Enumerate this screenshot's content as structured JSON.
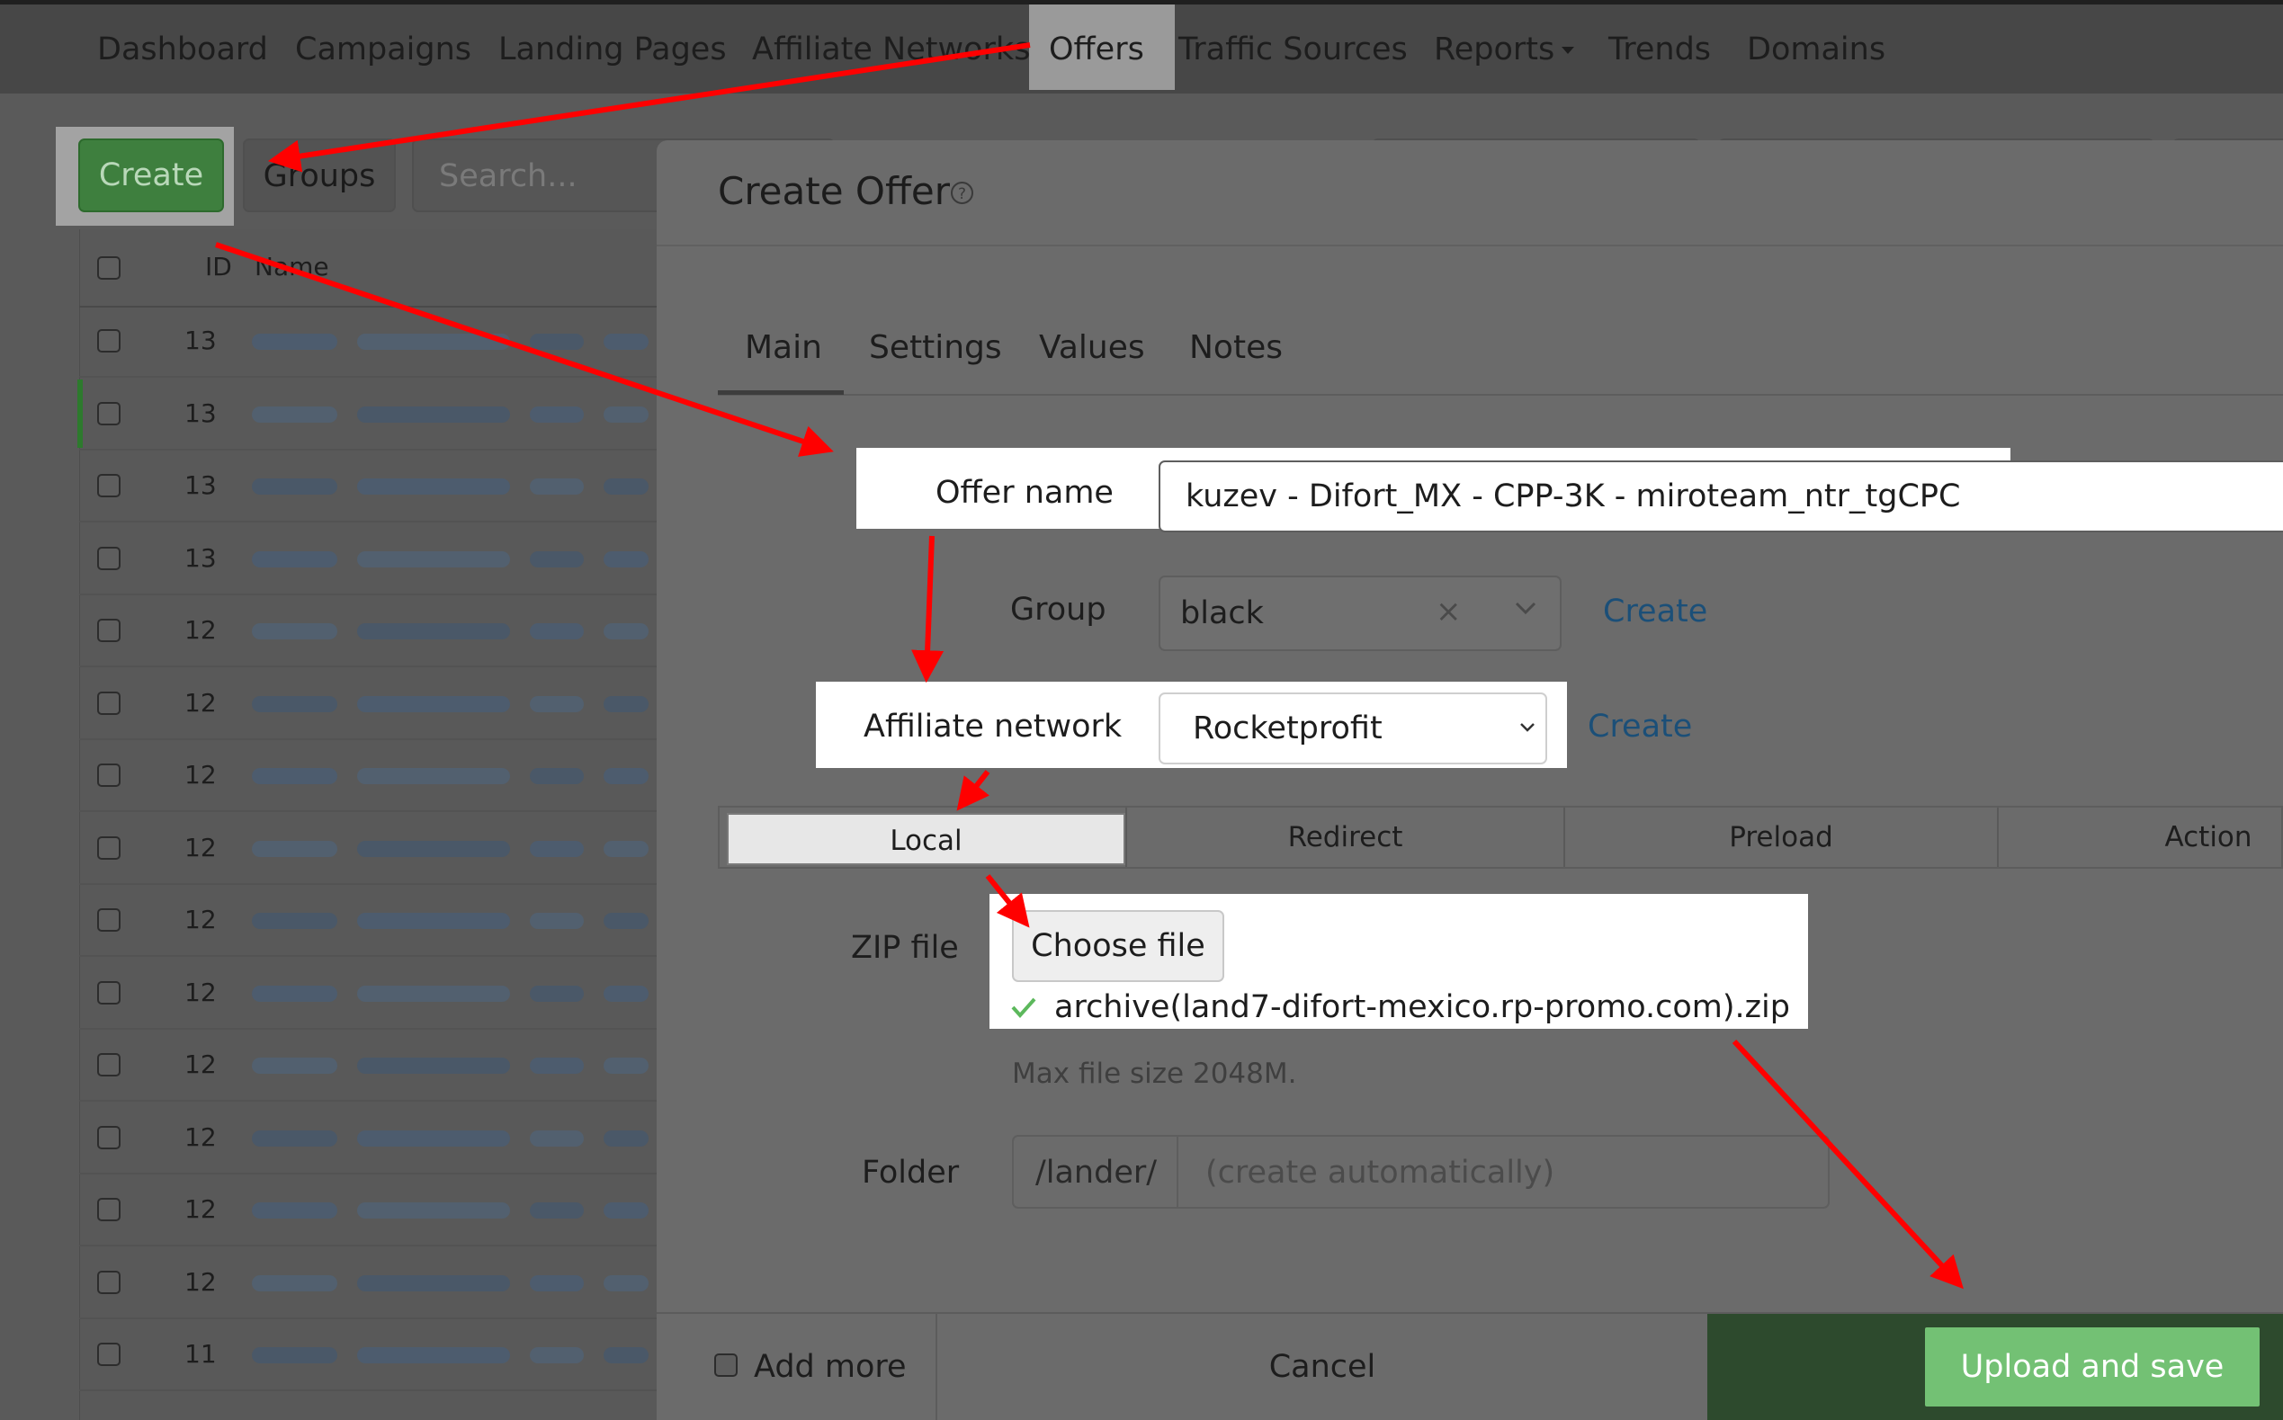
{
  "nav": {
    "items": [
      "Dashboard",
      "Campaigns",
      "Landing Pages",
      "Affiliate Networks",
      "Offers",
      "Traffic Sources",
      "Reports",
      "Trends",
      "Domains"
    ],
    "active": "Offers"
  },
  "toolbar": {
    "create_label": "Create",
    "groups_label": "Groups",
    "search_placeholder": "Search..."
  },
  "list": {
    "headers": {
      "id": "ID",
      "name": "Name"
    },
    "row_ids": [
      "13",
      "13",
      "13",
      "13",
      "12",
      "12",
      "12",
      "12",
      "12",
      "12",
      "12",
      "12",
      "12",
      "12",
      "11"
    ]
  },
  "modal": {
    "title": "Create Offer",
    "help_icon": "question-circle-icon",
    "tabs": [
      "Main",
      "Settings",
      "Values",
      "Notes"
    ],
    "active_tab": "Main",
    "offer_name": {
      "label": "Offer name",
      "value": "kuzev - Difort_MX - CPP-3K - miroteam_ntr_tgCPC"
    },
    "group": {
      "label": "Group",
      "value": "black",
      "create_link": "Create"
    },
    "affiliate_network": {
      "label": "Affiliate network",
      "value": "Rocketprofit",
      "create_link": "Create"
    },
    "type_tabs": [
      "Local",
      "Redirect",
      "Preload",
      "Action"
    ],
    "active_type": "Local",
    "zip": {
      "label": "ZIP file",
      "button": "Choose file",
      "file": "archive(land7-difort-mexico.rp-promo.com).zip",
      "hint": "Max file size 2048M."
    },
    "folder": {
      "label": "Folder",
      "prefix": "/lander/",
      "placeholder": "(create automatically)"
    },
    "footer": {
      "add_more": "Add more",
      "cancel": "Cancel",
      "upload": "Upload and save"
    }
  },
  "colors": {
    "annotation_arrow": "#ff0000",
    "success_green": "#5cb85c",
    "link_blue": "#1b4f78",
    "upload_button": "#73c174"
  }
}
